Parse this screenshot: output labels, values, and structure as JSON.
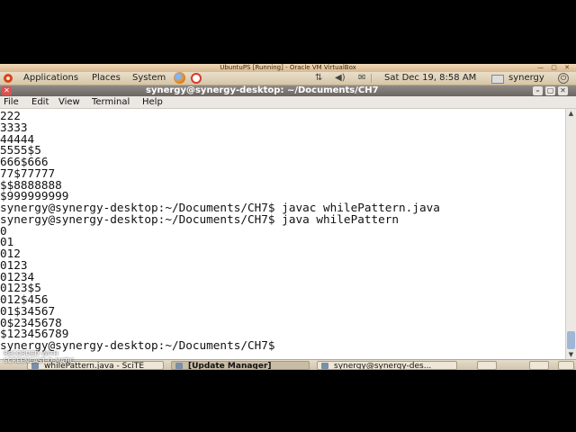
{
  "vbox": {
    "title": "UbuntuPS [Running] - Oracle VM VirtualBox"
  },
  "panel": {
    "applications": "Applications",
    "places": "Places",
    "system": "System",
    "datetime": "Sat Dec 19,  8:58 AM",
    "username": "synergy"
  },
  "terminal_window": {
    "title": "synergy@synergy-desktop: ~/Documents/CH7",
    "menu": [
      "File",
      "Edit",
      "View",
      "Terminal",
      "Help"
    ]
  },
  "terminal_lines": [
    "222",
    "3333",
    "44444",
    "5555$5",
    "666$666",
    "77$77777",
    "$$8888888",
    "$999999999",
    "synergy@synergy-desktop:~/Documents/CH7$ javac whilePattern.java",
    "synergy@synergy-desktop:~/Documents/CH7$ java whilePattern",
    "0",
    "01",
    "012",
    "0123",
    "01234",
    "0123$5",
    "012$456",
    "01$34567",
    "0$2345678",
    "$123456789",
    "synergy@synergy-desktop:~/Documents/CH7$ "
  ],
  "taskbar": [
    {
      "label": "whilePattern.java - SciTE"
    },
    {
      "label": "[Update Manager]"
    },
    {
      "label": "synergy@synergy-des..."
    }
  ],
  "watermark": {
    "line1": "RECORDED WITH",
    "line2": "SCREENCAST-O-MATIC"
  }
}
